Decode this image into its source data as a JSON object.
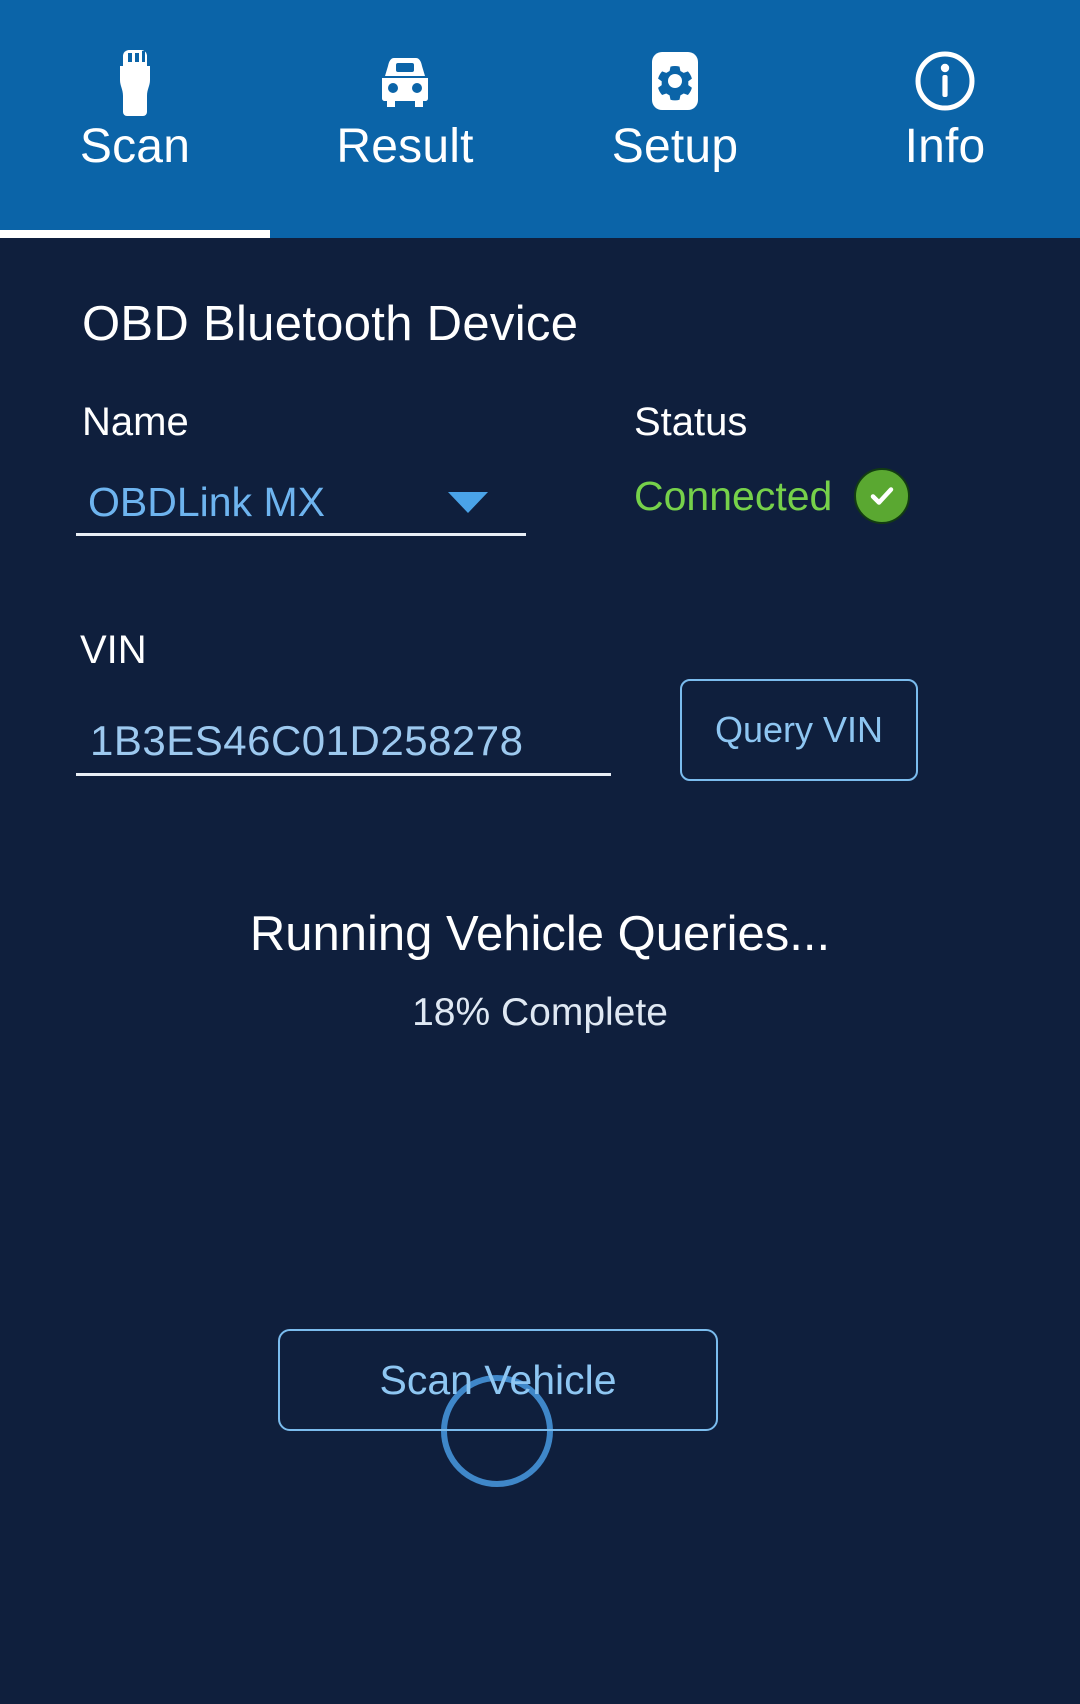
{
  "tabs": [
    {
      "label": "Scan",
      "icon": "obd-connector-icon",
      "active": true
    },
    {
      "label": "Result",
      "icon": "car-icon",
      "active": false
    },
    {
      "label": "Setup",
      "icon": "gear-icon",
      "active": false
    },
    {
      "label": "Info",
      "icon": "info-circle-icon",
      "active": false
    }
  ],
  "section": {
    "title": "OBD Bluetooth Device"
  },
  "device": {
    "name_label": "Name",
    "name_value": "OBDLink MX",
    "status_label": "Status",
    "status_value": "Connected",
    "status_icon": "check-circle-icon"
  },
  "vin": {
    "label": "VIN",
    "value": "1B3ES46C01D258278",
    "query_button": "Query VIN"
  },
  "progress": {
    "title": "Running Vehicle Queries...",
    "subtitle": "18% Complete",
    "percent": 18,
    "spinner_icon": "loading-ring-icon"
  },
  "actions": {
    "scan_button": "Scan Vehicle"
  },
  "colors": {
    "header_blue": "#0b64a8",
    "background_navy": "#0f1f3d",
    "accent_link_blue": "#6eb4ef",
    "status_green_text": "#76d14a",
    "status_badge_green": "#5aa831",
    "outline_blue": "#7bbcee",
    "spinner_blue": "#3f87c9"
  }
}
